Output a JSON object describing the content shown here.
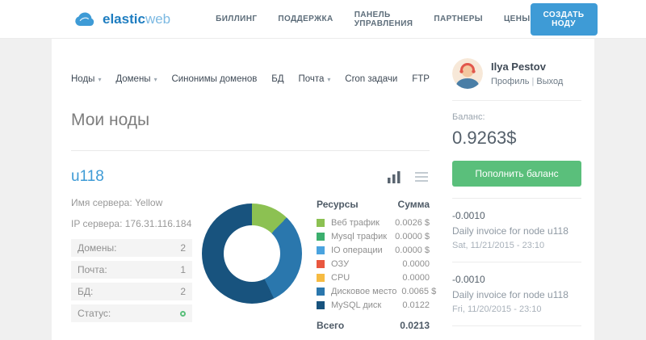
{
  "colors": {
    "accent": "#3e9bd6",
    "success": "#5abf7b",
    "brand_dark": "#1e7dc0",
    "brand_light": "#7cb9e2",
    "status_ok": "#5abf7b"
  },
  "icons": {
    "caret_down": "▾"
  },
  "header": {
    "brand_bold": "elastic",
    "brand_light": "web",
    "nav": [
      "БИЛЛИНГ",
      "ПОДДЕРЖКА",
      "ПАНЕЛЬ УПРАВЛЕНИЯ",
      "ПАРТНЕРЫ",
      "ЦЕНЫ"
    ],
    "create_button": "СОЗДАТЬ НОДУ"
  },
  "subnav": {
    "items": [
      {
        "label": "Ноды",
        "dropdown": true
      },
      {
        "label": "Домены",
        "dropdown": true
      },
      {
        "label": "Синонимы доменов",
        "dropdown": false
      },
      {
        "label": "БД",
        "dropdown": false
      },
      {
        "label": "Почта",
        "dropdown": true
      },
      {
        "label": "Cron задачи",
        "dropdown": false
      },
      {
        "label": "FTP",
        "dropdown": false
      }
    ]
  },
  "page": {
    "title": "Мои ноды"
  },
  "node": {
    "name": "u118",
    "server_name_label": "Имя сервера:",
    "server_name": "Yellow",
    "ip_label": "IP сервера:",
    "ip": "176.31.116.184",
    "stats": [
      {
        "label": "Домены:",
        "value": "2"
      },
      {
        "label": "Почта:",
        "value": "1"
      },
      {
        "label": "БД:",
        "value": "2"
      },
      {
        "label": "Статус:"
      }
    ]
  },
  "chart_data": {
    "type": "pie",
    "donut": true,
    "legend_position": "right",
    "labels": [
      "Веб трафик",
      "Mysql трафик",
      "IO операции",
      "ОЗУ",
      "CPU",
      "Дисковое место",
      "MySQL диск"
    ],
    "values": [
      0.0026,
      0,
      0,
      0,
      0,
      0.0065,
      0.0122
    ],
    "colors": [
      "#8cc152",
      "#3caf6e",
      "#4aa3df",
      "#e9573f",
      "#f6bb42",
      "#2a77ad",
      "#18537e"
    ],
    "total": 0.0213
  },
  "resources": {
    "col_resource": "Ресурсы",
    "col_sum": "Сумма",
    "amounts": [
      "0.0026 $",
      "0.0000 $",
      "0.0000 $",
      "0.0000",
      "0.0000",
      "0.0065 $",
      "0.0122"
    ],
    "total_label": "Всего",
    "total": "0.0213"
  },
  "sidebar": {
    "user_name": "Ilya Pestov",
    "profile_link": "Профиль",
    "links_separator": "|",
    "logout_link": "Выход",
    "balance_label": "Баланс:",
    "balance_value": "0.9263$",
    "topup_button": "Пополнить баланс",
    "invoices": [
      {
        "amount": "-0.0010",
        "description": "Daily invoice for node u118",
        "date": "Sat, 11/21/2015 - 23:10"
      },
      {
        "amount": "-0.0010",
        "description": "Daily invoice for node u118",
        "date": "Fri, 11/20/2015 - 23:10"
      }
    ]
  }
}
